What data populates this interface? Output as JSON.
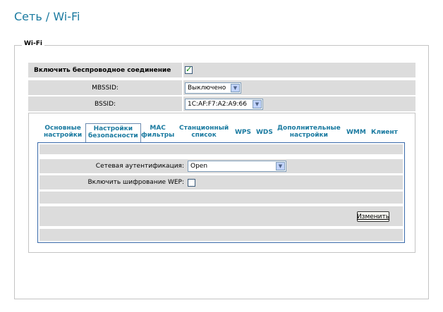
{
  "page": {
    "title": "Сеть / Wi-Fi"
  },
  "fieldset": {
    "legend": "Wi-Fi"
  },
  "settings": {
    "enable_wireless": {
      "label": "Включить беспроводное соединение",
      "checked": true
    },
    "mbssid": {
      "label": "MBSSID:",
      "value": "Выключено"
    },
    "bssid": {
      "label": "BSSID:",
      "value": "1C:AF:F7:A2:A9:66"
    }
  },
  "tabs": [
    {
      "line1": "Основные",
      "line2": "настройки",
      "active": false
    },
    {
      "line1": "Настройки",
      "line2": "безопасности",
      "active": true
    },
    {
      "line1": "MAC",
      "line2": "фильтры",
      "active": false
    },
    {
      "line1": "Станционный",
      "line2": "список",
      "active": false
    },
    {
      "line1": "WPS",
      "line2": "",
      "active": false
    },
    {
      "line1": "WDS",
      "line2": "",
      "active": false
    },
    {
      "line1": "Дополнительные",
      "line2": "настройки",
      "active": false
    },
    {
      "line1": "WMM",
      "line2": "",
      "active": false
    },
    {
      "line1": "Клиент",
      "line2": "",
      "active": false
    }
  ],
  "security": {
    "auth": {
      "label": "Сетевая аутентификация:",
      "value": "Open"
    },
    "wep": {
      "label": "Включить шифрование WEP:",
      "checked": false
    },
    "change_button": "Изменить"
  }
}
